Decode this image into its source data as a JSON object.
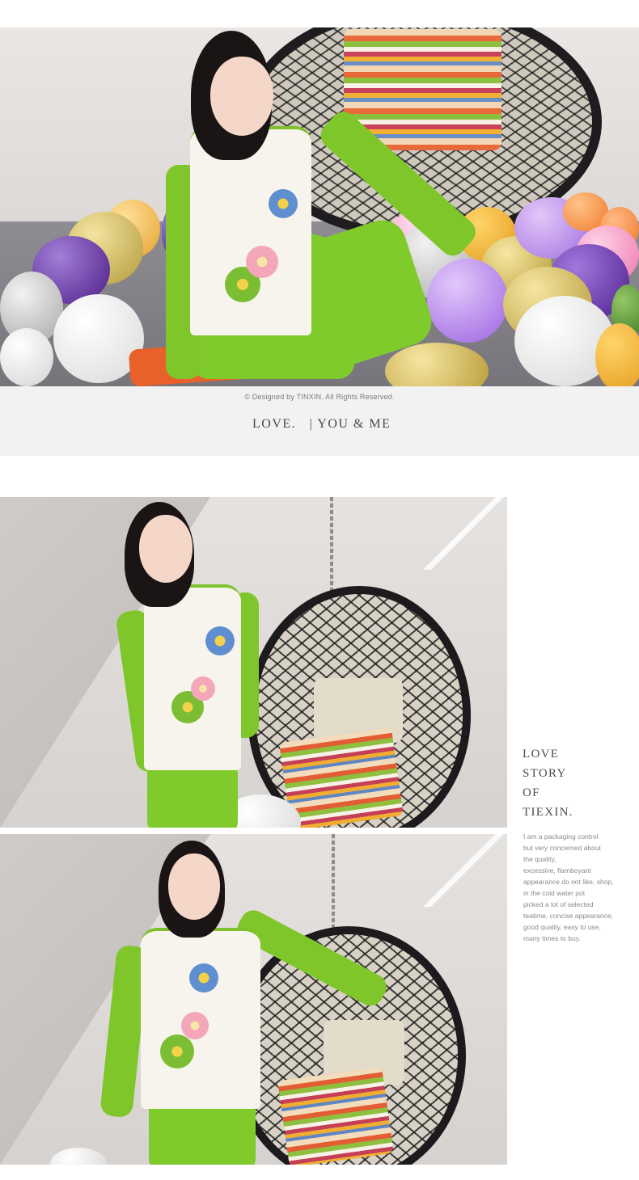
{
  "caption": {
    "copyright": "© Designed by TINXIN. All Rights Reserved.",
    "tagline": "LOVE.   | YOU & ME"
  },
  "side_text": {
    "heading_lines": [
      "LOVE",
      "STORY",
      "OF",
      "TIEXIN."
    ],
    "body_lines": [
      "I am a packaging control",
      "but very concerned about",
      "the quality,",
      "excessive, flamboyant",
      "appearance do not like, shop,",
      "in the cold water pot",
      "picked a lot of selected",
      "teatime, concise appearance,",
      "good quality, easy to use,",
      "many times to buy."
    ]
  },
  "colors": {
    "sleeve_green": "#7fc62a",
    "shirt_white": "#f6f4ec",
    "caption_bg": "#f2f2f2"
  }
}
